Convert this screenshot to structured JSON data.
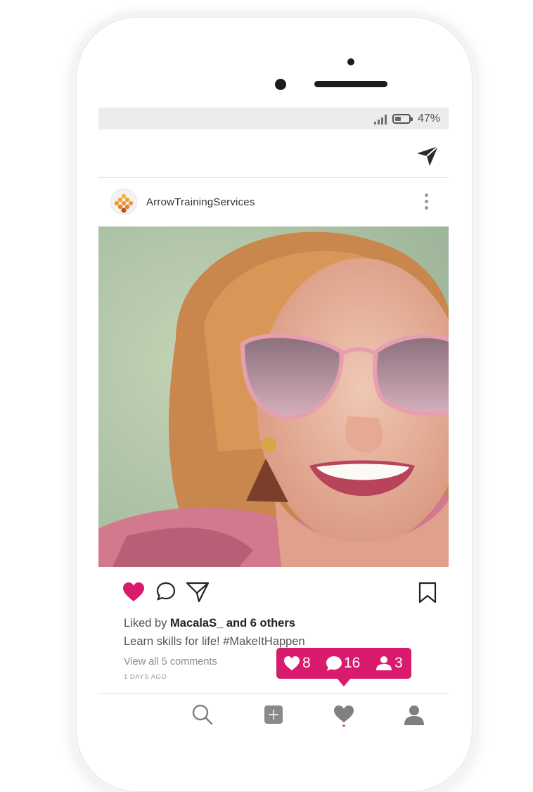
{
  "status_bar": {
    "battery_text": "47%",
    "battery_level": 0.47
  },
  "post": {
    "username": "ArrowTrainingServices",
    "liked_prefix": "Liked by ",
    "liked_users": "MacalaS_ and 6 others",
    "caption": "Learn skills for life! #MakeItHappen",
    "view_comments": "View all 5 comments",
    "time": "1 DAYS AGO",
    "liked": true
  },
  "notification": {
    "likes": "8",
    "comments": "16",
    "followers": "3"
  },
  "colors": {
    "accent": "#d81b6d",
    "status_bar_bg": "#ececec",
    "logo_orange": "#e8922a"
  },
  "icons": {
    "top": [
      "direct-message-icon"
    ],
    "actions": [
      "heart-icon",
      "comment-icon",
      "share-icon",
      "bookmark-icon"
    ],
    "nav": [
      "search-icon",
      "add-post-icon",
      "activity-heart-icon",
      "profile-icon"
    ]
  }
}
